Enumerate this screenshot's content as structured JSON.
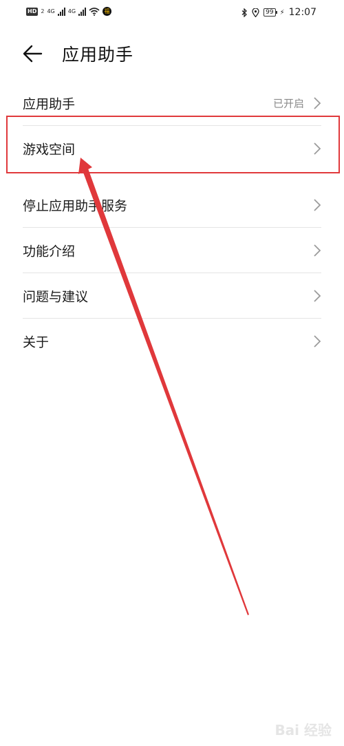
{
  "status_bar": {
    "hd": "HD",
    "sim": "2",
    "net1": "4G",
    "net2": "4G",
    "app_badge": "福",
    "battery": "99",
    "time": "12:07"
  },
  "header": {
    "title": "应用助手"
  },
  "list": {
    "items": [
      {
        "label": "应用助手",
        "value": "已开启"
      },
      {
        "label": "游戏空间",
        "value": ""
      },
      {
        "label": "停止应用助手服务",
        "value": ""
      },
      {
        "label": "功能介绍",
        "value": ""
      },
      {
        "label": "问题与建议",
        "value": ""
      },
      {
        "label": "关于",
        "value": ""
      }
    ]
  },
  "annotation": {
    "highlight_color": "#e0383b"
  },
  "watermark": {
    "text": "Bai 经验"
  }
}
